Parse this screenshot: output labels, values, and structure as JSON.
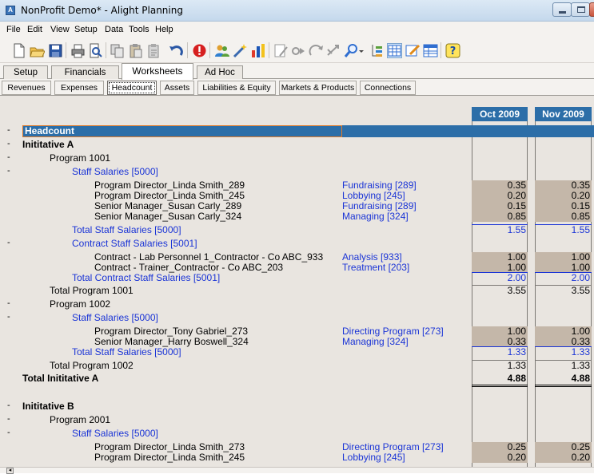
{
  "window": {
    "title": "NonProfit Demo* - Alight Planning",
    "app_icon": "A"
  },
  "menu": [
    "File",
    "Edit",
    "View",
    "Setup",
    "Data",
    "Tools",
    "Help"
  ],
  "toolbar_icons": [
    "new-icon",
    "open-icon",
    "save-icon",
    "print-icon",
    "print-preview-icon",
    "copy-icon",
    "paste-icon",
    "paste-special-icon",
    "undo-icon",
    "alert-icon",
    "people-icon",
    "wand-icon",
    "chart-icon",
    "edit-doc-icon",
    "play-icon",
    "redo-icon",
    "shuffle-icon",
    "search-icon",
    "tree-icon",
    "grid-view-icon",
    "pencil-icon",
    "table-icon",
    "help-icon"
  ],
  "main_tabs": [
    "Setup",
    "Financials",
    "Worksheets",
    "Ad Hoc"
  ],
  "active_main_tab": "Worksheets",
  "sub_tabs": [
    "Revenues",
    "Expenses",
    "Headcount",
    "Assets",
    "Liabilities & Equity",
    "Markets & Products",
    "Connections"
  ],
  "active_sub_tab": "Headcount",
  "columns": [
    "Oct 2009",
    "Nov 2009"
  ],
  "colors": {
    "header_blue": "#2c6ea8",
    "link_blue": "#1a34d6",
    "shade": "#c4b7a9",
    "panel": "#e9e5e0"
  },
  "rows": [
    {
      "toggle": "-",
      "label": "Headcount",
      "acct": "",
      "v1": "",
      "v2": ""
    },
    {
      "toggle": "-",
      "label": "Inititative A",
      "acct": "",
      "v1": "",
      "v2": ""
    },
    {
      "toggle": "-",
      "label": "Program 1001",
      "acct": "",
      "v1": "",
      "v2": ""
    },
    {
      "toggle": "-",
      "label": "Staff Salaries [5000]",
      "acct": "",
      "v1": "",
      "v2": ""
    },
    {
      "toggle": "",
      "label": "Program Director_Linda Smith_289",
      "acct": "Fundraising [289]",
      "v1": "0.35",
      "v2": "0.35"
    },
    {
      "toggle": "",
      "label": "Program Director_Linda Smith_245",
      "acct": "Lobbying [245]",
      "v1": "0.20",
      "v2": "0.20"
    },
    {
      "toggle": "",
      "label": "Senior Manager_Susan Carly_289",
      "acct": "Fundraising [289]",
      "v1": "0.15",
      "v2": "0.15"
    },
    {
      "toggle": "",
      "label": "Senior Manager_Susan Carly_324",
      "acct": "Managing [324]",
      "v1": "0.85",
      "v2": "0.85"
    },
    {
      "toggle": "",
      "label": "Total Staff Salaries [5000]",
      "acct": "",
      "v1": "1.55",
      "v2": "1.55"
    },
    {
      "toggle": "-",
      "label": "Contract Staff Salaries [5001]",
      "acct": "",
      "v1": "",
      "v2": ""
    },
    {
      "toggle": "",
      "label": "Contract - Lab Personnel 1_Contractor - Co ABC_933",
      "acct": "Analysis [933]",
      "v1": "1.00",
      "v2": "1.00"
    },
    {
      "toggle": "",
      "label": "Contract - Trainer_Contractor - Co ABC_203",
      "acct": "Treatment [203]",
      "v1": "1.00",
      "v2": "1.00"
    },
    {
      "toggle": "",
      "label": "Total Contract Staff Salaries [5001]",
      "acct": "",
      "v1": "2.00",
      "v2": "2.00"
    },
    {
      "toggle": "",
      "label": "Total Program 1001",
      "acct": "",
      "v1": "3.55",
      "v2": "3.55"
    },
    {
      "toggle": "-",
      "label": "Program 1002",
      "acct": "",
      "v1": "",
      "v2": ""
    },
    {
      "toggle": "-",
      "label": "Staff Salaries [5000]",
      "acct": "",
      "v1": "",
      "v2": ""
    },
    {
      "toggle": "",
      "label": "Program Director_Tony Gabriel_273",
      "acct": "Directing Program [273]",
      "v1": "1.00",
      "v2": "1.00"
    },
    {
      "toggle": "",
      "label": "Senior Manager_Harry Boswell_324",
      "acct": "Managing [324]",
      "v1": "0.33",
      "v2": "0.33"
    },
    {
      "toggle": "",
      "label": "Total Staff Salaries [5000]",
      "acct": "",
      "v1": "1.33",
      "v2": "1.33"
    },
    {
      "toggle": "",
      "label": "Total Program 1002",
      "acct": "",
      "v1": "1.33",
      "v2": "1.33"
    },
    {
      "toggle": "",
      "label": "Total Inititative A",
      "acct": "",
      "v1": "4.88",
      "v2": "4.88"
    },
    {
      "toggle": "-",
      "label": "Inititative B",
      "acct": "",
      "v1": "",
      "v2": ""
    },
    {
      "toggle": "-",
      "label": "Program 2001",
      "acct": "",
      "v1": "",
      "v2": ""
    },
    {
      "toggle": "-",
      "label": "Staff Salaries [5000]",
      "acct": "",
      "v1": "",
      "v2": ""
    },
    {
      "toggle": "",
      "label": "Program Director_Linda Smith_273",
      "acct": "Directing Program [273]",
      "v1": "0.25",
      "v2": "0.25"
    },
    {
      "toggle": "",
      "label": "Program Director_Linda Smith_245",
      "acct": "Lobbying [245]",
      "v1": "0.20",
      "v2": "0.20"
    }
  ]
}
